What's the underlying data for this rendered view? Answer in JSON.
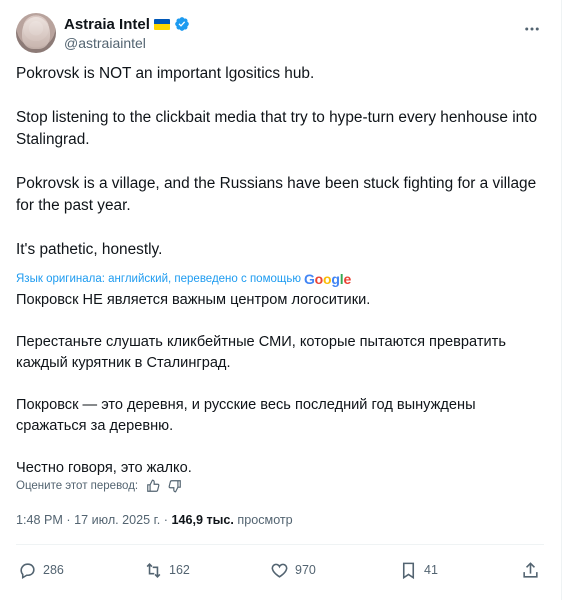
{
  "author": {
    "display_name": "Astraia Intel",
    "handle": "@astraiaintel"
  },
  "tweet": {
    "paragraphs": [
      "Pokrovsk is NOT an important lgositics hub.",
      "Stop listening to the clickbait media that try to hype-turn every henhouse into Stalingrad.",
      "Pokrovsk is a village, and the Russians have been stuck fighting for a village for the past year.",
      "It's pathetic, honestly."
    ]
  },
  "translation": {
    "note": "Язык оригинала: английский, переведено с помощью",
    "provider": "Google",
    "paragraphs": [
      "Покровск НЕ является важным центром логоситики.",
      "Перестаньте слушать кликбейтные СМИ, которые пытаются превратить каждый курятник в Сталинград.",
      "Покровск — это деревня, и русские весь последний год вынуждены сражаться за деревню.",
      "Честно говоря, это жалко."
    ],
    "rate_prompt": "Оцените этот перевод:"
  },
  "meta": {
    "time": "1:48 PM",
    "date": "17 июл. 2025 г.",
    "separator": "·",
    "views_count": "146,9 тыс.",
    "views_label": "просмотр"
  },
  "actions": {
    "replies": "286",
    "reposts": "162",
    "likes": "970",
    "bookmarks": "41"
  },
  "colors": {
    "text": "#0f1419",
    "secondary": "#536471",
    "link": "#1d9bf0",
    "verified": "#1d9bf0"
  }
}
